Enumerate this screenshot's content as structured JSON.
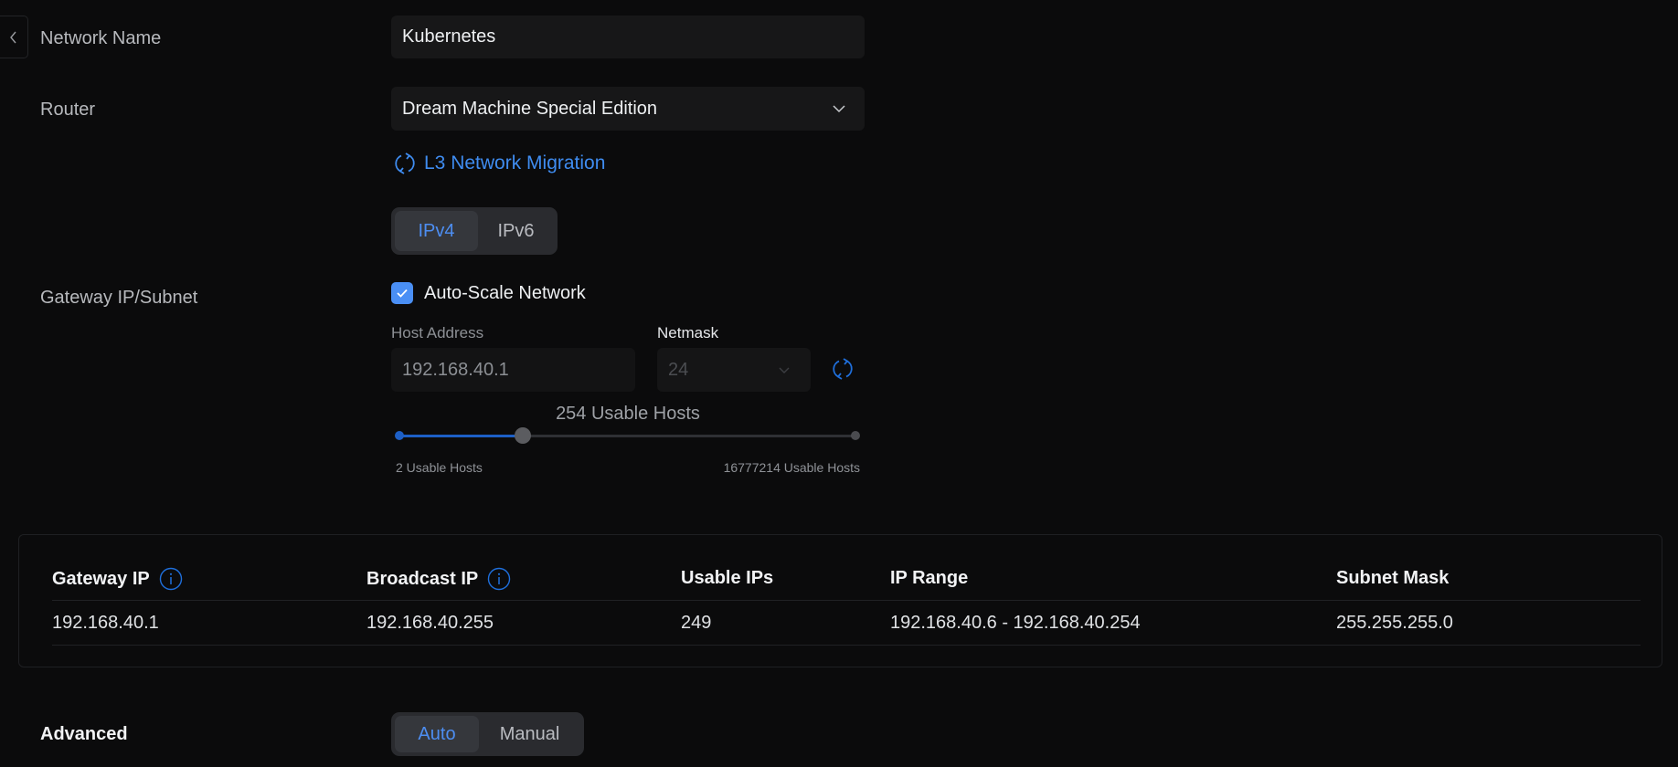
{
  "form": {
    "network_name": {
      "label": "Network Name",
      "value": "Kubernetes"
    },
    "router": {
      "label": "Router",
      "selected": "Dream Machine Special Edition"
    },
    "migration_link": "L3 Network Migration",
    "ip_version": {
      "options": [
        "IPv4",
        "IPv6"
      ],
      "selected": "IPv4"
    },
    "gateway": {
      "label": "Gateway IP/Subnet",
      "auto_scale": {
        "label": "Auto-Scale Network",
        "checked": true
      },
      "host_address": {
        "label": "Host Address",
        "value": "192.168.40.1"
      },
      "netmask": {
        "label": "Netmask",
        "value": "24"
      },
      "usable_hosts": {
        "label": "254 Usable Hosts",
        "min_label": "2 Usable Hosts",
        "max_label": "16777214 Usable Hosts",
        "fraction": 0.27
      }
    },
    "advanced": {
      "label": "Advanced",
      "options": [
        "Auto",
        "Manual"
      ],
      "selected": "Auto"
    }
  },
  "summary_table": {
    "headers": [
      "Gateway IP",
      "Broadcast IP",
      "Usable IPs",
      "IP Range",
      "Subnet Mask"
    ],
    "rows": [
      [
        "192.168.40.1",
        "192.168.40.255",
        "249",
        "192.168.40.6 - 192.168.40.254",
        "255.255.255.0"
      ]
    ]
  },
  "colors": {
    "accent": "#3f8cf0",
    "checkbox": "#4a8ff5",
    "background": "#0b0b0c",
    "field": "#171718"
  }
}
